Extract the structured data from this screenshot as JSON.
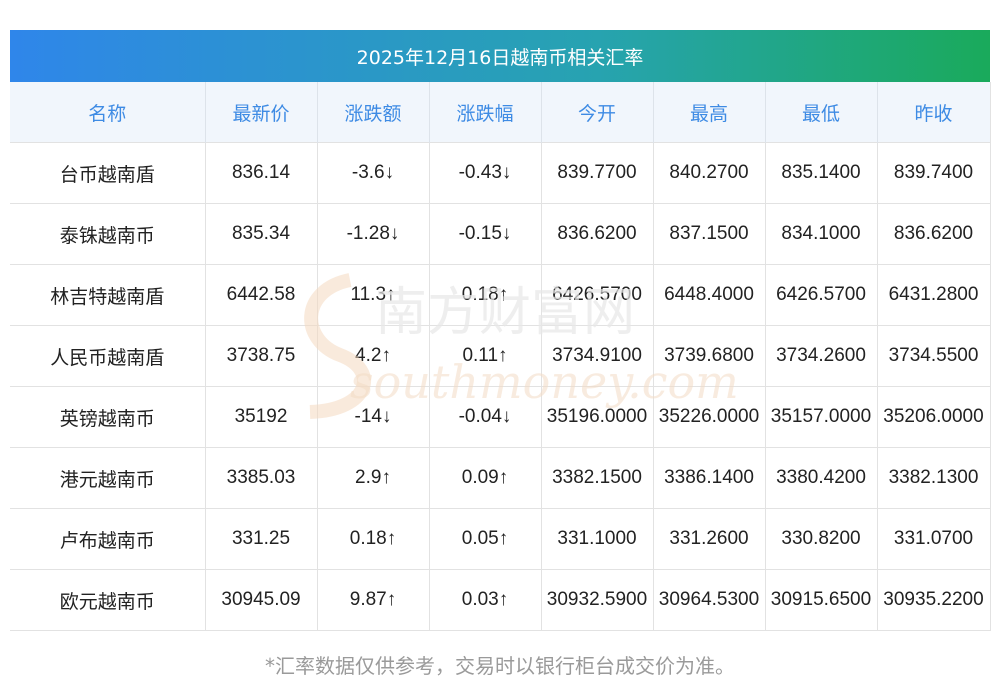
{
  "title": "2025年12月16日越南币相关汇率",
  "columns": [
    "名称",
    "最新价",
    "涨跌额",
    "涨跌幅",
    "今开",
    "最高",
    "最低",
    "昨收"
  ],
  "rows": [
    {
      "name": "台币越南盾",
      "latest": "836.14",
      "change": "-3.6↓",
      "pct": "-0.43↓",
      "open": "839.7700",
      "high": "840.2700",
      "low": "835.1400",
      "prev": "839.7400",
      "dir": "down"
    },
    {
      "name": "泰铢越南币",
      "latest": "835.34",
      "change": "-1.28↓",
      "pct": "-0.15↓",
      "open": "836.6200",
      "high": "837.1500",
      "low": "834.1000",
      "prev": "836.6200",
      "dir": "down"
    },
    {
      "name": "林吉特越南盾",
      "latest": "6442.58",
      "change": "11.3↑",
      "pct": "0.18↑",
      "open": "6426.5700",
      "high": "6448.4000",
      "low": "6426.5700",
      "prev": "6431.2800",
      "dir": "up"
    },
    {
      "name": "人民币越南盾",
      "latest": "3738.75",
      "change": "4.2↑",
      "pct": "0.11↑",
      "open": "3734.9100",
      "high": "3739.6800",
      "low": "3734.2600",
      "prev": "3734.5500",
      "dir": "up"
    },
    {
      "name": "英镑越南币",
      "latest": "35192",
      "change": "-14↓",
      "pct": "-0.04↓",
      "open": "35196.0000",
      "high": "35226.0000",
      "low": "35157.0000",
      "prev": "35206.0000",
      "dir": "down"
    },
    {
      "name": "港元越南币",
      "latest": "3385.03",
      "change": "2.9↑",
      "pct": "0.09↑",
      "open": "3382.1500",
      "high": "3386.1400",
      "low": "3380.4200",
      "prev": "3382.1300",
      "dir": "up"
    },
    {
      "name": "卢布越南币",
      "latest": "331.25",
      "change": "0.18↑",
      "pct": "0.05↑",
      "open": "331.1000",
      "high": "331.2600",
      "low": "330.8200",
      "prev": "331.0700",
      "dir": "up"
    },
    {
      "name": "欧元越南币",
      "latest": "30945.09",
      "change": "9.87↑",
      "pct": "0.03↑",
      "open": "30932.5900",
      "high": "30964.5300",
      "low": "30915.6500",
      "prev": "30935.2200",
      "dir": "up"
    }
  ],
  "watermark": {
    "cn": "南方财富网",
    "en": "southmoney.com"
  },
  "footnote": "*汇率数据仅供参考，交易时以银行柜台成交价为准。",
  "colors": {
    "up": "#e8201f",
    "down": "#1a8a2b",
    "header_text": "#3e8be4",
    "header_bg": "#f1f6fc"
  }
}
